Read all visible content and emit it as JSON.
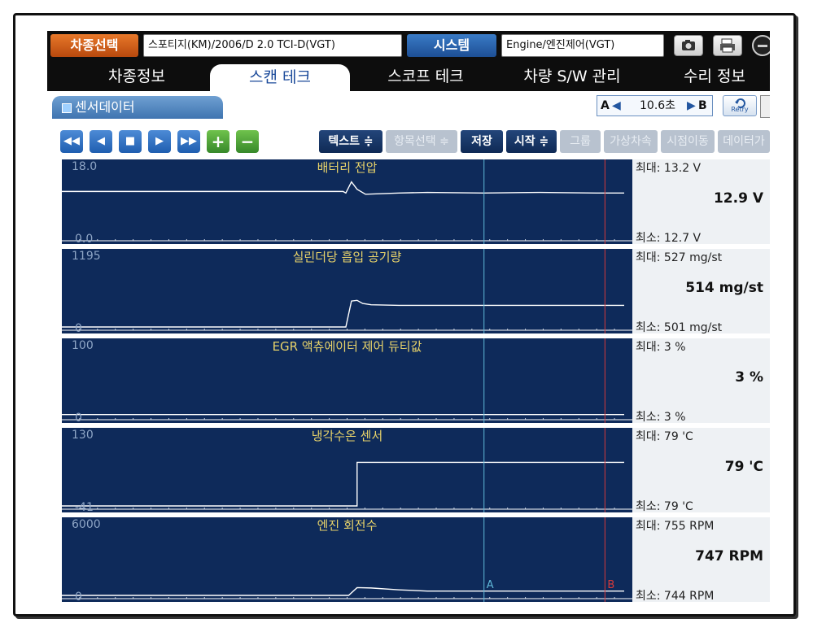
{
  "topbar": {
    "vehicle_select_label": "차종선택",
    "vehicle_value": "스포티지(KM)/2006/D 2.0 TCI-D(VGT)",
    "system_label": "시스템",
    "system_value": "Engine/엔진제어(VGT)"
  },
  "tabs": [
    {
      "label": "차종정보",
      "active": false
    },
    {
      "label": "스캔 테크",
      "active": true
    },
    {
      "label": "스코프 테크",
      "active": false
    },
    {
      "label": "차량 S/W 관리",
      "active": false
    },
    {
      "label": "수리 정보",
      "active": false
    }
  ],
  "panel": {
    "title": "센서데이터"
  },
  "cursor": {
    "a_label": "A",
    "b_label": "B",
    "span": "10.6초",
    "retry_label": "Retry"
  },
  "toolbar": {
    "text_btn": "텍스트 ≑",
    "item_select": "항목선택 ≑",
    "save": "저장",
    "start": "시작 ≑",
    "group": "그룹",
    "virtual_vehicle": "가상차속",
    "time_move": "시점이동",
    "data": "데이터가"
  },
  "colors": {
    "plot_bg": "#0e2a5a",
    "trace": "#ffffff",
    "cursor_a": "#5fb8d8",
    "cursor_b": "#d63a3a",
    "title": "#e8d36a"
  },
  "sensors": [
    {
      "title": "배터리 전압",
      "axis_max": "18.0",
      "axis_min": "0.0",
      "max": "최대:  13.2 V",
      "current": "12.9 V",
      "min": "최소:  12.7 V",
      "trace": [
        [
          0,
          0.745
        ],
        [
          0.5,
          0.745
        ],
        [
          0.505,
          0.72
        ],
        [
          0.515,
          0.9
        ],
        [
          0.525,
          0.78
        ],
        [
          0.54,
          0.7
        ],
        [
          0.6,
          0.72
        ],
        [
          0.65,
          0.73
        ],
        [
          0.75,
          0.72
        ],
        [
          0.85,
          0.73
        ],
        [
          0.95,
          0.72
        ],
        [
          1.0,
          0.72
        ]
      ]
    },
    {
      "title": "실린더당 흡입 공기량",
      "axis_max": "1195",
      "axis_min": "0",
      "max": "최대:    527 mg/st",
      "current": "514 mg/st",
      "min": "최소:    501 mg/st",
      "trace": [
        [
          0,
          0.0
        ],
        [
          0.505,
          0.0
        ],
        [
          0.515,
          0.42
        ],
        [
          0.525,
          0.43
        ],
        [
          0.535,
          0.38
        ],
        [
          0.55,
          0.36
        ],
        [
          0.6,
          0.35
        ],
        [
          0.7,
          0.35
        ],
        [
          0.8,
          0.35
        ],
        [
          0.9,
          0.35
        ],
        [
          1.0,
          0.35
        ]
      ]
    },
    {
      "title": "EGR 액츄에이터 제어 듀티값",
      "axis_max": "100",
      "axis_min": "0",
      "max": "최대:     3 %",
      "current": "3 %",
      "min": "최소:     3 %",
      "trace": [
        [
          0,
          0.03
        ],
        [
          1.0,
          0.03
        ]
      ]
    },
    {
      "title": "냉각수온 센서",
      "axis_max": "130",
      "axis_min": "-41",
      "max": "최대:    79 'C",
      "current": "79 'C",
      "min": "최소:    79 'C",
      "trace": [
        [
          0,
          0.0
        ],
        [
          0.525,
          0.0
        ],
        [
          0.525,
          0.705
        ],
        [
          1.0,
          0.705
        ]
      ]
    },
    {
      "title": "엔진 회전수",
      "axis_max": "6000",
      "axis_min": "0",
      "max": "최대:    755 RPM",
      "current": "747 RPM",
      "min": "최소:    744 RPM",
      "trace": [
        [
          0,
          0.0
        ],
        [
          0.51,
          0.0
        ],
        [
          0.525,
          0.126
        ],
        [
          0.55,
          0.12
        ],
        [
          0.6,
          0.09
        ],
        [
          0.65,
          0.07
        ],
        [
          0.75,
          0.07
        ],
        [
          0.85,
          0.07
        ],
        [
          1.0,
          0.07
        ]
      ]
    }
  ],
  "cursors": {
    "a_pos": 0.74,
    "b_pos": 0.952
  }
}
